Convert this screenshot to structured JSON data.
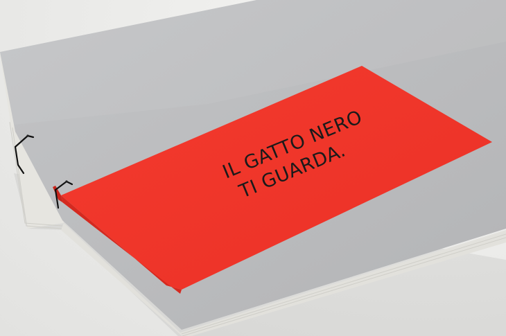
{
  "photo": {
    "subject": "notebook-with-red-band",
    "band_text_line1": "IL GATTO NERO",
    "band_text_line2": "TI GUARDA."
  },
  "colors": {
    "background": "#ececea",
    "cover_grey": "#b9babc",
    "cover_grey_light": "#c6c7c9",
    "pages_edge": "#e7e6e1",
    "band_red": "#f2362b",
    "band_red_dark": "#d92a20",
    "thread": "#111111",
    "ink": "#1a1a1a"
  }
}
